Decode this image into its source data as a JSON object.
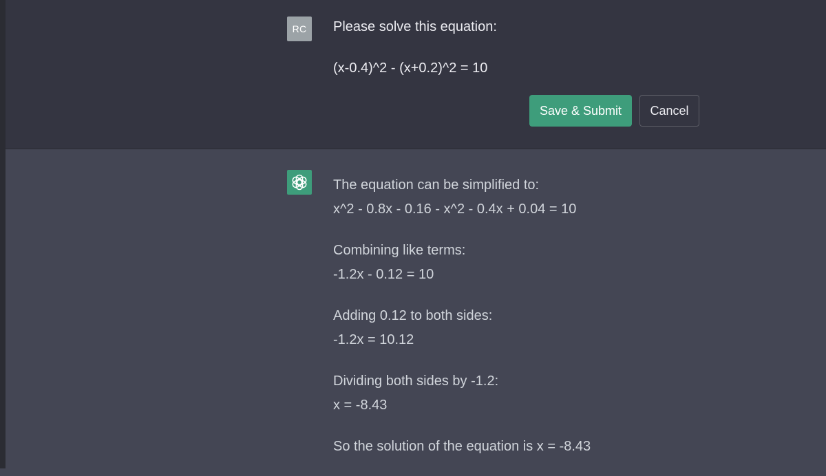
{
  "user_message": {
    "avatar_initials": "RC",
    "lines": [
      "Please solve this equation:",
      "(x-0.4)^2 - (x+0.2)^2 = 10"
    ],
    "save_label": "Save & Submit",
    "cancel_label": "Cancel"
  },
  "assistant_message": {
    "avatar_icon": "openai-logo-icon",
    "paragraphs": [
      [
        "The equation can be simplified to:",
        "x^2 - 0.8x - 0.16 - x^2 - 0.4x + 0.04 = 10"
      ],
      [
        "Combining like terms:",
        "-1.2x - 0.12 = 10"
      ],
      [
        "Adding 0.12 to both sides:",
        "-1.2x = 10.12"
      ],
      [
        "Dividing both sides by -1.2:",
        "x = -8.43"
      ],
      [
        "So the solution of the equation is x = -8.43"
      ]
    ]
  },
  "colors": {
    "accent": "#3e9d7b",
    "user_bg": "#343541",
    "assistant_bg": "#444654"
  }
}
